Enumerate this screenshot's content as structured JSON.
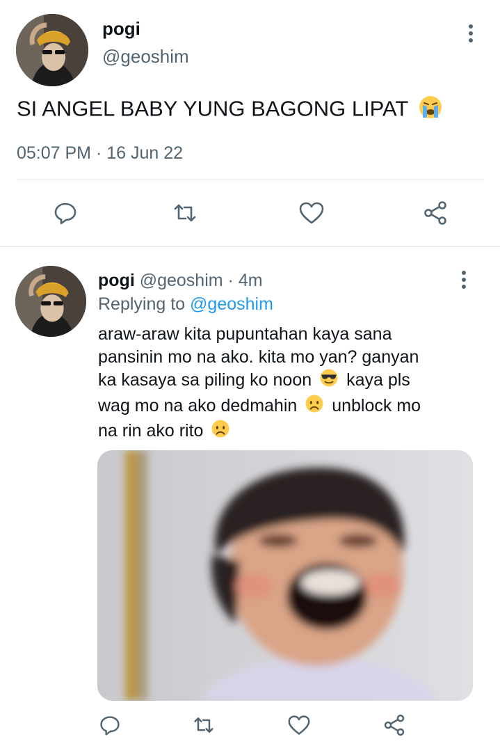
{
  "main_tweet": {
    "display_name": "pogi",
    "handle": "@geoshim",
    "text": "SI ANGEL BABY YUNG BAGONG LIPAT",
    "text_emoji": "loudly-crying-face",
    "time": "05:07 PM",
    "separator": "·",
    "date": "16 Jun 22"
  },
  "reply_tweet": {
    "display_name": "pogi",
    "handle": "@geoshim",
    "separator": "·",
    "age": "4m",
    "replying_prefix": "Replying to",
    "replying_handle": "@geoshim",
    "lines": [
      "araw-araw kita pupuntahan kaya sana",
      "pansinin mo na ako. kita mo yan? ganyan",
      "ka kasaya sa piling ko noon",
      "kaya pls",
      "wag mo na ako dedmahin",
      "unblock mo",
      "na rin ako rito"
    ],
    "emojis": [
      "smiling-face-with-sunglasses",
      "worried-face",
      "worried-face"
    ],
    "media": "photo-laughing-person"
  },
  "actions": [
    "reply-icon",
    "retweet-icon",
    "like-icon",
    "share-icon"
  ],
  "colors": {
    "text": "#0f1419",
    "muted": "#536471",
    "link": "#1d9bf0",
    "divider": "#e1e4e6",
    "icon": "#536471"
  }
}
